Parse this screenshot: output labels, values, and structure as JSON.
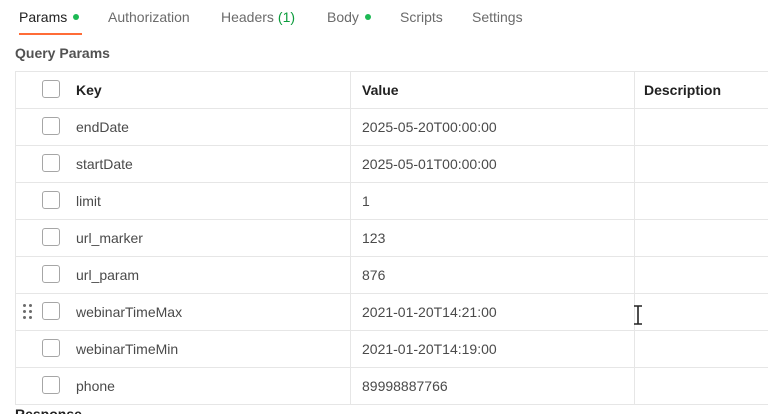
{
  "tabs": [
    {
      "label": "Params",
      "active": true,
      "dot": true
    },
    {
      "label": "Authorization",
      "active": false,
      "dot": false
    },
    {
      "label": "Headers",
      "count": "(1)",
      "active": false,
      "dot": false
    },
    {
      "label": "Body",
      "active": false,
      "dot": true
    },
    {
      "label": "Scripts",
      "active": false,
      "dot": false
    },
    {
      "label": "Settings",
      "active": false,
      "dot": false
    }
  ],
  "section_title": "Query Params",
  "table": {
    "headers": {
      "key": "Key",
      "value": "Value",
      "description": "Description"
    },
    "rows": [
      {
        "key": "endDate",
        "value": "2025-05-20T00:00:00",
        "description": ""
      },
      {
        "key": "startDate",
        "value": "2025-05-01T00:00:00",
        "description": ""
      },
      {
        "key": "limit",
        "value": "1",
        "description": ""
      },
      {
        "key": "url_marker",
        "value": "123",
        "description": ""
      },
      {
        "key": "url_param",
        "value": "876",
        "description": ""
      },
      {
        "key": "webinarTimeMax",
        "value": "2021-01-20T14:21:00",
        "description": ""
      },
      {
        "key": "webinarTimeMin",
        "value": "2021-01-20T14:19:00",
        "description": ""
      },
      {
        "key": "phone",
        "value": "89998887766",
        "description": ""
      }
    ]
  },
  "bottom": {
    "label": "Response"
  },
  "colors": {
    "accent": "#ff6c37",
    "status_dot": "#1db954",
    "count": "#0c9c3c"
  },
  "icons": [
    "drag-handle-icon",
    "text-cursor-icon",
    "checkbox"
  ]
}
